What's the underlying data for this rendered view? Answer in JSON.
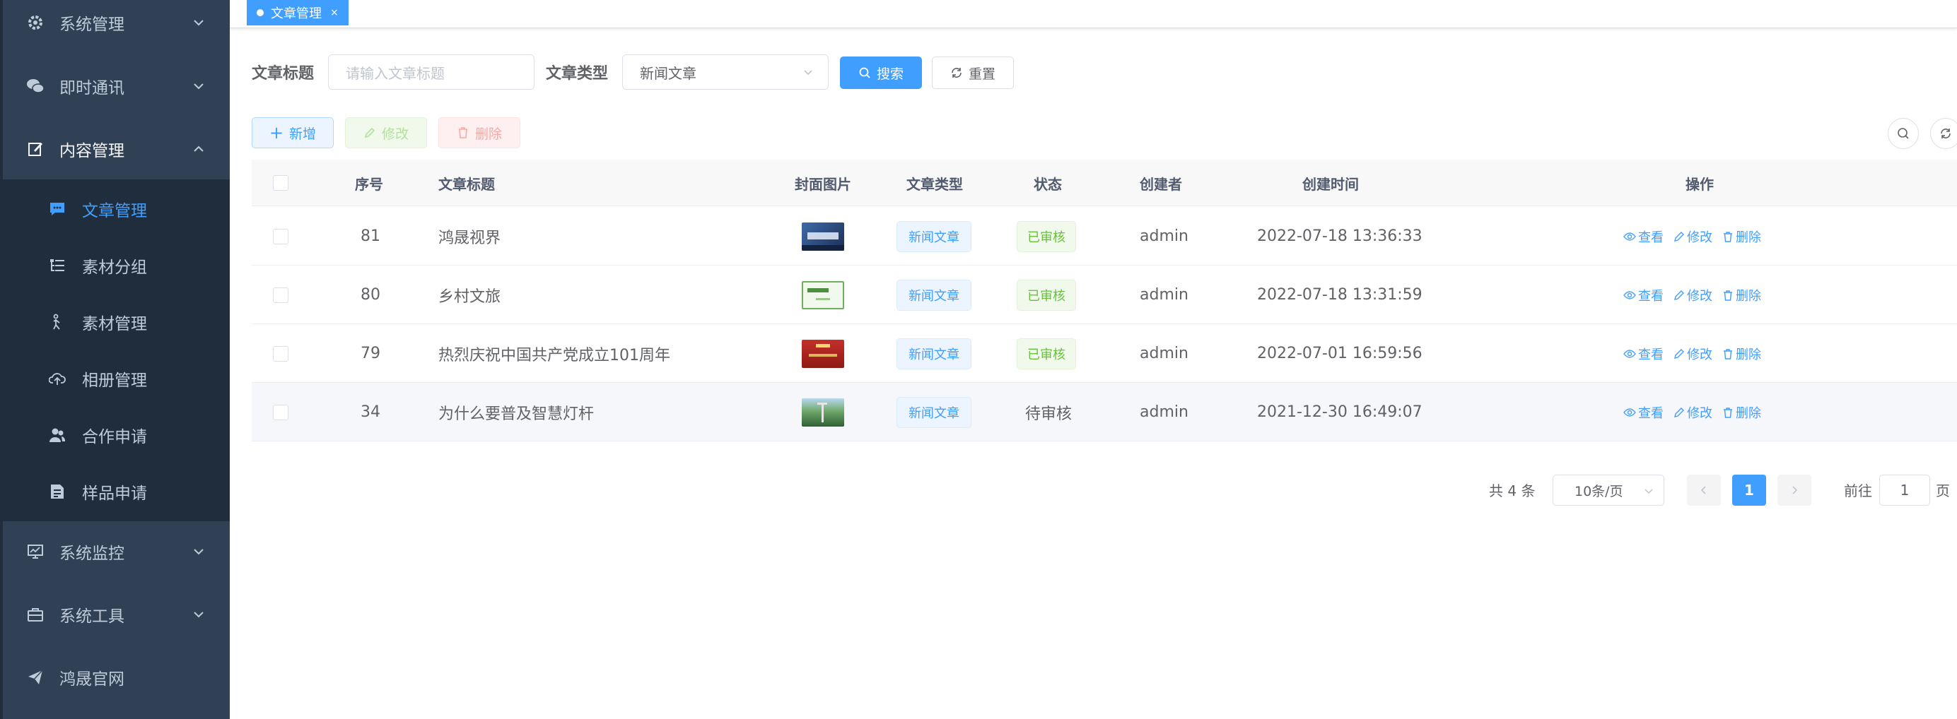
{
  "sidebar": {
    "items": [
      {
        "label": "系统管理",
        "icon": "gear-icon"
      },
      {
        "label": "即时通讯",
        "icon": "wechat-icon"
      },
      {
        "label": "内容管理",
        "icon": "edit-icon"
      },
      {
        "label": "系统监控",
        "icon": "monitor-icon"
      },
      {
        "label": "系统工具",
        "icon": "toolbox-icon"
      },
      {
        "label": "鸿晟官网",
        "icon": "send-icon"
      }
    ],
    "subitems": [
      {
        "label": "文章管理",
        "icon": "message-icon",
        "active": true
      },
      {
        "label": "素材分组",
        "icon": "tree-list-icon"
      },
      {
        "label": "素材管理",
        "icon": "gesture-icon"
      },
      {
        "label": "相册管理",
        "icon": "cloud-upload-icon"
      },
      {
        "label": "合作申请",
        "icon": "peoples-icon"
      },
      {
        "label": "样品申请",
        "icon": "document-icon"
      }
    ]
  },
  "tags_view": {
    "active_tag": "文章管理",
    "close": "×"
  },
  "search": {
    "title_label": "文章标题",
    "title_placeholder": "请输入文章标题",
    "type_label": "文章类型",
    "type_value": "新闻文章",
    "search_button": "搜索",
    "reset_button": "重置"
  },
  "toolbar": {
    "add": "新增",
    "edit": "修改",
    "delete": "删除"
  },
  "table": {
    "headers": {
      "index": "序号",
      "title": "文章标题",
      "cover": "封面图片",
      "type": "文章类型",
      "status": "状态",
      "creator": "创建者",
      "created_at": "创建时间",
      "ops": "操作"
    },
    "ops": {
      "view": "查看",
      "edit": "修改",
      "delete": "删除"
    },
    "rows": [
      {
        "id": "81",
        "title": "鸿晟视界",
        "type": "新闻文章",
        "status": "已审核",
        "creator": "admin",
        "created_at": "2022-07-18 13:36:33",
        "thumb_color": "#2b4a78",
        "thumb_text": "鸿晟视界"
      },
      {
        "id": "80",
        "title": "乡村文旅",
        "type": "新闻文章",
        "status": "已审核",
        "creator": "admin",
        "created_at": "2022-07-18 13:31:59",
        "thumb_color": "#e8f3e2",
        "thumb_text": "乡村文旅"
      },
      {
        "id": "79",
        "title": "热烈庆祝中国共产党成立101周年",
        "type": "新闻文章",
        "status": "已审核",
        "creator": "admin",
        "created_at": "2022-07-01 16:59:56",
        "thumb_color": "#b3261e",
        "thumb_text": "热烈庆祝"
      },
      {
        "id": "34",
        "title": "为什么要普及智慧灯杆",
        "type": "新闻文章",
        "status": "待审核",
        "creator": "admin",
        "created_at": "2021-12-30 16:49:07",
        "thumb_color": "#3f7a4a",
        "thumb_text": ""
      }
    ]
  },
  "pagination": {
    "total": "共 4 条",
    "page_size": "10条/页",
    "current": "1",
    "goto_label": "前往",
    "goto_value": "1",
    "page_unit": "页"
  }
}
